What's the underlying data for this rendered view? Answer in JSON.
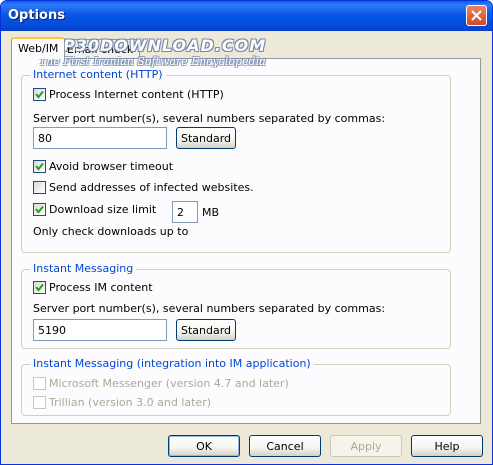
{
  "window": {
    "title": "Options"
  },
  "watermark": {
    "main": "P30DOWNLOAD.COM",
    "sub": "The First Iranian Software Encyclopedia"
  },
  "tabs": [
    {
      "label": "Web/IM"
    },
    {
      "label": "Email check"
    }
  ],
  "internet": {
    "legend": "Internet content (HTTP)",
    "process_label": "Process Internet content (HTTP)",
    "port_label": "Server port number(s), several numbers separated by commas:",
    "port_value": "80",
    "standard_label": "Standard",
    "avoid_timeout_label": "Avoid browser timeout",
    "send_addresses_label": "Send addresses of infected websites.",
    "download_limit_label": "Download size limit",
    "download_limit_value": "2",
    "download_limit_unit": "MB",
    "only_check_label": "Only check downloads up to"
  },
  "im": {
    "legend": "Instant Messaging",
    "process_label": "Process IM content",
    "port_label": "Server port number(s), several numbers separated by commas:",
    "port_value": "5190",
    "standard_label": "Standard"
  },
  "integration": {
    "legend": "Instant Messaging (integration into IM application)",
    "messenger_label": "Microsoft Messenger (version 4.7 and later)",
    "trillian_label": "Trillian (version 3.0 and later)"
  },
  "footer": {
    "ok_label": "OK",
    "cancel_label": "Cancel",
    "apply_label": "Apply",
    "help_label": "Help"
  }
}
